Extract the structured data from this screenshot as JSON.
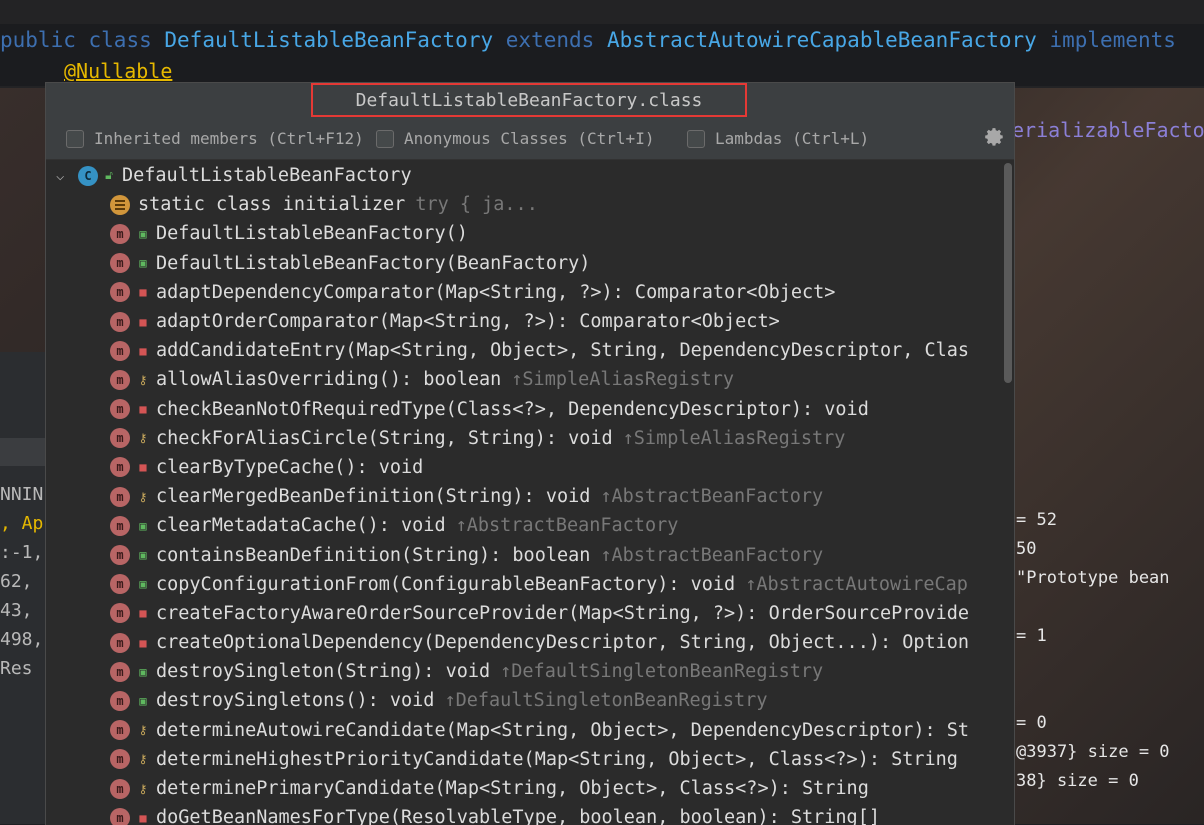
{
  "editor": {
    "line1": {
      "public_kw": "public",
      "class_kw": "class",
      "class_name": "DefaultListableBeanFactory",
      "extends_kw": "extends",
      "super_name": "AbstractAutowireCapableBeanFactory",
      "implements_kw": "implements"
    },
    "annotation": "@Nullable",
    "right_fragment": "erializableFacto",
    "debug_values": [
      "= 52",
      "50",
      "\"Prototype bean",
      "",
      "= 1",
      "",
      "",
      "= 0",
      "@3937}  size = 0",
      "38}  size = 0"
    ],
    "left_fragments": [
      "NNIN",
      ", Ap",
      ":-1,",
      "62,",
      "43,",
      "498,",
      " Res"
    ]
  },
  "popup": {
    "title": "DefaultListableBeanFactory.class",
    "filters": [
      {
        "label": "Inherited members (Ctrl+F12)"
      },
      {
        "label": "Anonymous Classes (Ctrl+I)"
      },
      {
        "label": "Lambdas (Ctrl+L)"
      }
    ],
    "root": {
      "icon": "class-icon",
      "letter": "C",
      "label": "DefaultListableBeanFactory"
    },
    "items": [
      {
        "kind": "static",
        "vis": "none",
        "label": "static class initializer",
        "inherited": "try {            ja..."
      },
      {
        "kind": "method",
        "vis": "public",
        "label": "DefaultListableBeanFactory()",
        "inherited": ""
      },
      {
        "kind": "method",
        "vis": "public",
        "label": "DefaultListableBeanFactory(BeanFactory)",
        "inherited": ""
      },
      {
        "kind": "method",
        "vis": "private",
        "label": "adaptDependencyComparator(Map<String, ?>): Comparator<Object>",
        "inherited": ""
      },
      {
        "kind": "method",
        "vis": "private",
        "label": "adaptOrderComparator(Map<String, ?>): Comparator<Object>",
        "inherited": ""
      },
      {
        "kind": "method",
        "vis": "private",
        "label": "addCandidateEntry(Map<String, Object>, String, DependencyDescriptor, Clas",
        "inherited": ""
      },
      {
        "kind": "method",
        "vis": "protected",
        "label": "allowAliasOverriding(): boolean",
        "inherited": "↑SimpleAliasRegistry"
      },
      {
        "kind": "method",
        "vis": "private",
        "label": "checkBeanNotOfRequiredType(Class<?>, DependencyDescriptor): void",
        "inherited": ""
      },
      {
        "kind": "method",
        "vis": "protected",
        "label": "checkForAliasCircle(String, String): void",
        "inherited": "↑SimpleAliasRegistry"
      },
      {
        "kind": "method",
        "vis": "private",
        "label": "clearByTypeCache(): void",
        "inherited": ""
      },
      {
        "kind": "method",
        "vis": "protected",
        "label": "clearMergedBeanDefinition(String): void",
        "inherited": "↑AbstractBeanFactory"
      },
      {
        "kind": "method",
        "vis": "public",
        "label": "clearMetadataCache(): void",
        "inherited": "↑AbstractBeanFactory"
      },
      {
        "kind": "method",
        "vis": "public",
        "label": "containsBeanDefinition(String): boolean",
        "inherited": "↑AbstractBeanFactory"
      },
      {
        "kind": "method",
        "vis": "public",
        "label": "copyConfigurationFrom(ConfigurableBeanFactory): void",
        "inherited": "↑AbstractAutowireCap"
      },
      {
        "kind": "method",
        "vis": "private",
        "label": "createFactoryAwareOrderSourceProvider(Map<String, ?>): OrderSourceProvide",
        "inherited": ""
      },
      {
        "kind": "method",
        "vis": "private",
        "label": "createOptionalDependency(DependencyDescriptor, String, Object...): Option",
        "inherited": ""
      },
      {
        "kind": "method",
        "vis": "public",
        "label": "destroySingleton(String): void",
        "inherited": "↑DefaultSingletonBeanRegistry"
      },
      {
        "kind": "method",
        "vis": "public",
        "label": "destroySingletons(): void",
        "inherited": "↑DefaultSingletonBeanRegistry"
      },
      {
        "kind": "method",
        "vis": "protected",
        "label": "determineAutowireCandidate(Map<String, Object>, DependencyDescriptor): St",
        "inherited": ""
      },
      {
        "kind": "method",
        "vis": "protected",
        "label": "determineHighestPriorityCandidate(Map<String, Object>, Class<?>): String",
        "inherited": ""
      },
      {
        "kind": "method",
        "vis": "protected",
        "label": "determinePrimaryCandidate(Map<String, Object>, Class<?>): String",
        "inherited": ""
      },
      {
        "kind": "method",
        "vis": "private",
        "label": "doGetBeanNamesForType(ResolvableType, boolean, boolean): String[]",
        "inherited": ""
      }
    ]
  }
}
